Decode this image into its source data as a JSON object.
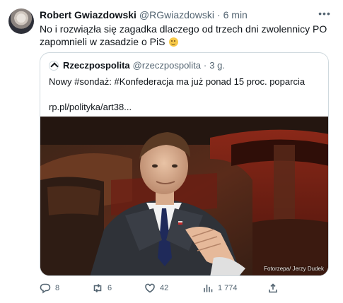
{
  "tweet": {
    "author_name": "Robert Gwiazdowski",
    "author_handle": "@RGwiazdowski",
    "separator": "·",
    "time": "6 min",
    "text": "No i rozwiązła się zagadka dlaczego od trzech dni zwolennicy PO zapomnieli w zasadzie o PiS",
    "emoji": "wink-emoji",
    "more_icon": "more-icon"
  },
  "quote": {
    "author_name": "Rzeczpospolita",
    "author_handle": "@rzeczpospolita",
    "separator": "·",
    "time": "3 g.",
    "text": "Nowy #sondaż: #Konfederacja ma już ponad 15 proc. poparcia",
    "link": "rp.pl/polityka/art38...",
    "photo_credit": "Fotorzepa/ Jerzy Dudek"
  },
  "actions": {
    "replies": "8",
    "retweets": "6",
    "likes": "42",
    "views": "1 774"
  },
  "colors": {
    "text": "#0f1419",
    "secondary": "#536471",
    "border": "#cfd9de",
    "photo_seat_red": "#7a1e14",
    "photo_wood": "#5a2b1a",
    "photo_suit": "#2f3238"
  }
}
